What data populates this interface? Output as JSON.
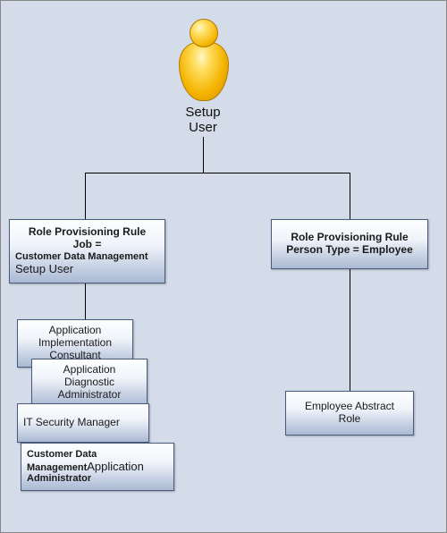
{
  "actor": {
    "label_line1": "Setup",
    "label_line2": "User"
  },
  "left_rule": {
    "line1": "Role Provisioning Rule",
    "line2": "Job =",
    "line3": "Customer Data Management",
    "line4": "Setup User"
  },
  "right_rule": {
    "line1": "Role Provisioning Rule",
    "line2": "Person Type = Employee"
  },
  "left_roles": {
    "r1": {
      "l1": "Application",
      "l2": "Implementation",
      "l3": "Consultant"
    },
    "r2": {
      "l1": "Application",
      "l2": "Diagnostic",
      "l3": "Administrator"
    },
    "r3": {
      "l1": "IT Security Manager"
    },
    "r4": {
      "l1": "Customer Data",
      "l2a": "Management",
      "l2b": "Application",
      "l3": "Administrator"
    }
  },
  "right_role": {
    "l1": "Employee Abstract",
    "l2": "Role"
  }
}
